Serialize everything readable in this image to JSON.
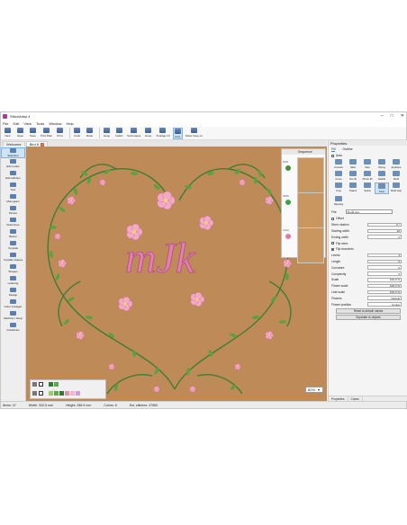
{
  "window": {
    "title": "StitchArtist 4"
  },
  "menu": [
    "File",
    "Edit",
    "View",
    "Tools",
    "Window",
    "Help"
  ],
  "toolbar": [
    "New",
    "Open",
    "Save",
    "Print Plan",
    "Print",
    "Undo",
    "Redo",
    "Hoop",
    "Fabric",
    "Techniques",
    "Hoop",
    "To Edge 1X",
    "Auto",
    "Show hoop on"
  ],
  "tabs": [
    {
      "label": "Welcome",
      "closable": false
    },
    {
      "label": "Bird 8",
      "closable": true
    }
  ],
  "left_tools": [
    "Selection",
    "Edit nodes",
    "Edit stitches",
    "Text",
    "Monogram",
    "Picture",
    "Draw lines",
    "Bézier",
    "Crystals",
    "Crystals shapes",
    "Shapes",
    "Lettering",
    "Design",
    "Color manager",
    "Machine / Hoop",
    "Guidelines"
  ],
  "sequence": {
    "title": "Sequence",
    "rows": [
      {
        "label": "DSS",
        "color": "#4a8e3a"
      },
      {
        "label": "3996",
        "color": "#3fa24a"
      },
      {
        "label": "1323",
        "color": "#e07aa8"
      }
    ]
  },
  "palette": {
    "swatches": [
      "#2f7d32",
      "#5fa84f",
      "#9ccc65",
      "#e58fb3",
      "#f4b6cc",
      "#c9a0dc"
    ]
  },
  "zoom": "82%",
  "properties": {
    "title": "Properties",
    "tabs": [
      "Fill",
      "Outline"
    ],
    "auto_label": "Auto",
    "stitch_types": [
      "Artwork",
      "Satin",
      "Step",
      "Piping",
      "Applique",
      "Cross",
      "Net fill",
      "Photo fill",
      "Radial",
      "Motif",
      "Crop",
      "Tatami",
      "Spiral",
      "Flow",
      "Motif step",
      "Rippling"
    ],
    "file_label": "File",
    "file_value": "Floral one",
    "offset_label": "Offset",
    "params": [
      {
        "label": "Stem rotation",
        "value": "0 °"
      },
      {
        "label": "Starting width",
        "value": "20"
      },
      {
        "label": "Ending width",
        "value": "0"
      },
      {
        "label": "Flip stem",
        "value": ""
      },
      {
        "label": "Flip branches",
        "value": ""
      },
      {
        "label": "Levels",
        "value": "4"
      },
      {
        "label": "Length",
        "value": "5"
      },
      {
        "label": "Curvature",
        "value": "6"
      },
      {
        "label": "Complexity",
        "value": "5"
      },
      {
        "label": "Scale",
        "value": "100.0 %"
      },
      {
        "label": "Flower scale",
        "value": "100.0 %"
      },
      {
        "label": "Leaf scale",
        "value": "100.0 %"
      },
      {
        "label": "Flowers",
        "value": "Default"
      },
      {
        "label": "Flower position",
        "value": "Center"
      }
    ],
    "buttons": [
      "Reset to default values",
      "Separate to objects"
    ],
    "bottom_tabs": [
      "Properties",
      "Colors"
    ]
  },
  "status": {
    "items": "Items: 47",
    "width": "Width: 332.5 mm",
    "height": "Height: 286.5 mm",
    "colors": "Colors: 6",
    "stitches": "Est. stitches: 47560"
  },
  "monogram": "mJk"
}
